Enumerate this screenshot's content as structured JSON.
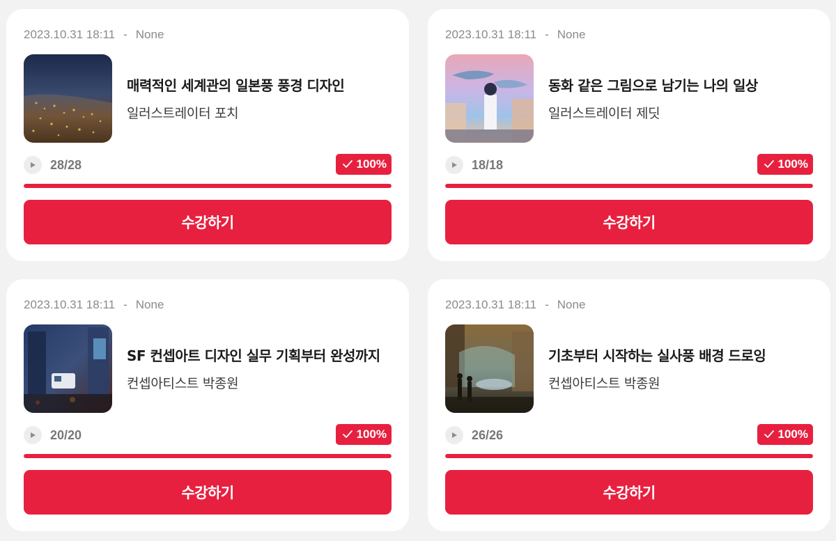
{
  "theme": {
    "accent": "#e8203f",
    "background": "#f2f2f2",
    "card": "#ffffff"
  },
  "courses": [
    {
      "date": "2023.10.31 18:11",
      "separator": "-",
      "status": "None",
      "title": "매력적인 세계관의 일본풍 풍경 디자인",
      "author": "일러스트레이터 포치",
      "lessons": "28/28",
      "completion": "100%",
      "progress": 1.0,
      "thumbnail_icon": "night-city-illustration",
      "button_label": "수강하기"
    },
    {
      "date": "2023.10.31 18:11",
      "separator": "-",
      "status": "None",
      "title": "동화 같은 그림으로 남기는 나의 일상",
      "author": "일러스트레이터 제딧",
      "lessons": "18/18",
      "completion": "100%",
      "progress": 1.0,
      "thumbnail_icon": "whale-sky-illustration",
      "button_label": "수강하기"
    },
    {
      "date": "2023.10.31 18:11",
      "separator": "-",
      "status": "None",
      "title": "SF 컨셉아트 디자인 실무 기획부터 완성까지",
      "author": "컨셉아티스트 박종원",
      "lessons": "20/20",
      "completion": "100%",
      "progress": 1.0,
      "thumbnail_icon": "scifi-street-illustration",
      "button_label": "수강하기"
    },
    {
      "date": "2023.10.31 18:11",
      "separator": "-",
      "status": "None",
      "title": "기초부터 시작하는 실사풍 배경 드로잉",
      "author": "컨셉아티스트 박종원",
      "lessons": "26/26",
      "completion": "100%",
      "progress": 1.0,
      "thumbnail_icon": "fantasy-plaza-illustration",
      "button_label": "수강하기"
    }
  ]
}
